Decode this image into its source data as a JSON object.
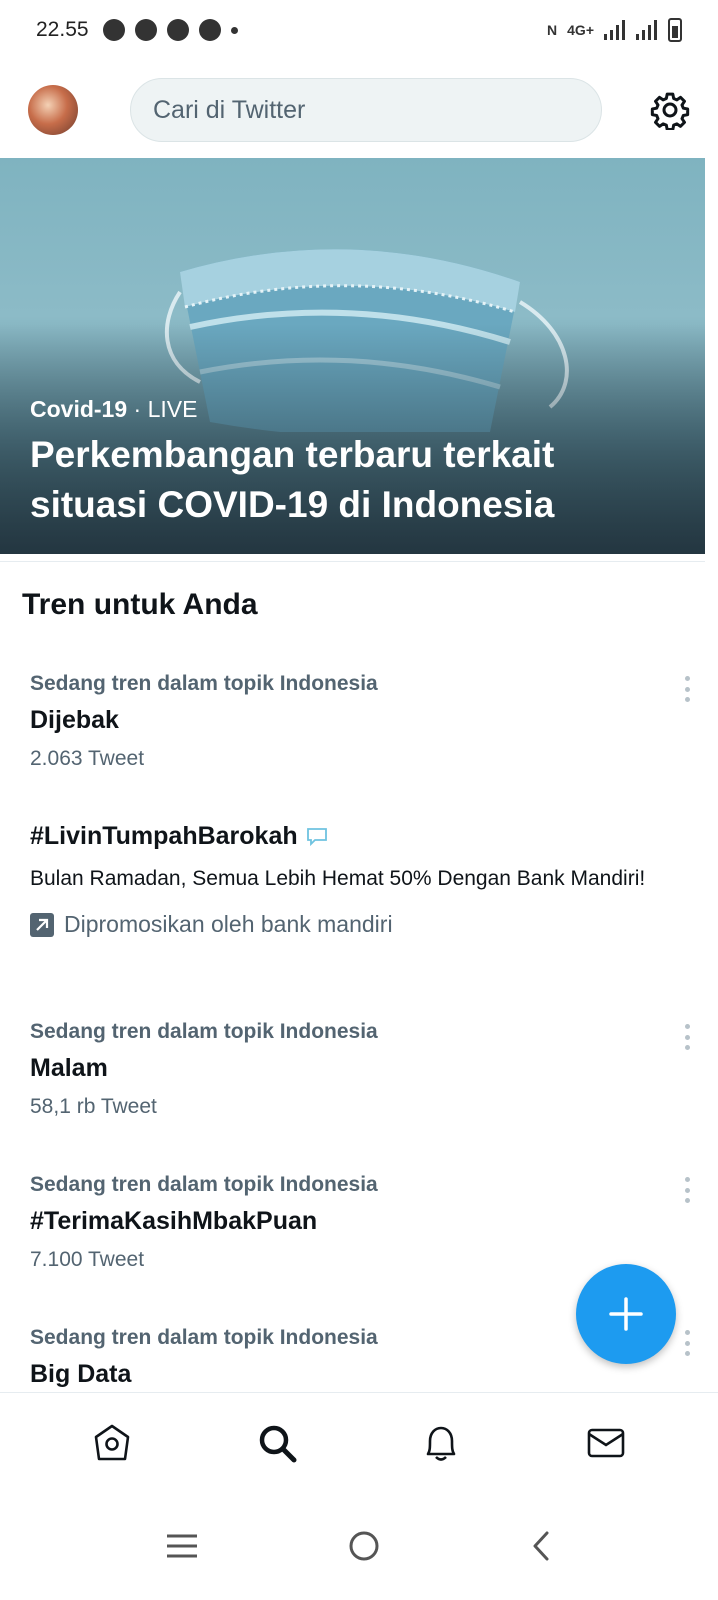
{
  "status_bar": {
    "time": "22.55",
    "network": "4G+"
  },
  "header": {
    "search_placeholder": "Cari di Twitter"
  },
  "hero": {
    "category": "Covid-19",
    "separator": " · ",
    "badge": "LIVE",
    "title": "Perkembangan terbaru terkait situasi COVID-19 di Indonesia"
  },
  "section": {
    "title": "Tren untuk Anda"
  },
  "trends": [
    {
      "category": "Sedang tren dalam topik Indonesia",
      "name": "Dijebak",
      "count": "2.063 Tweet"
    },
    {
      "category": "Sedang tren dalam topik Indonesia",
      "name": "Malam",
      "count": "58,1 rb Tweet"
    },
    {
      "category": "Sedang tren dalam topik Indonesia",
      "name": "#TerimaKasihMbakPuan",
      "count": "7.100 Tweet"
    },
    {
      "category": "Sedang tren dalam topik Indonesia",
      "name": "Big Data",
      "count": ""
    }
  ],
  "promoted": {
    "name": "#LivinTumpahBarokah",
    "description": "Bulan Ramadan, Semua Lebih Hemat 50% Dengan Bank Mandiri!",
    "promoted_by": "Dipromosikan oleh bank mandiri"
  },
  "colors": {
    "accent": "#1d9bf0",
    "secondary_text": "#536471",
    "primary_text": "#0f1419"
  },
  "icons": {
    "fab": "plus-icon",
    "settings": "gear-icon",
    "nav": [
      "home-icon",
      "search-icon",
      "bell-icon",
      "mail-icon"
    ]
  }
}
